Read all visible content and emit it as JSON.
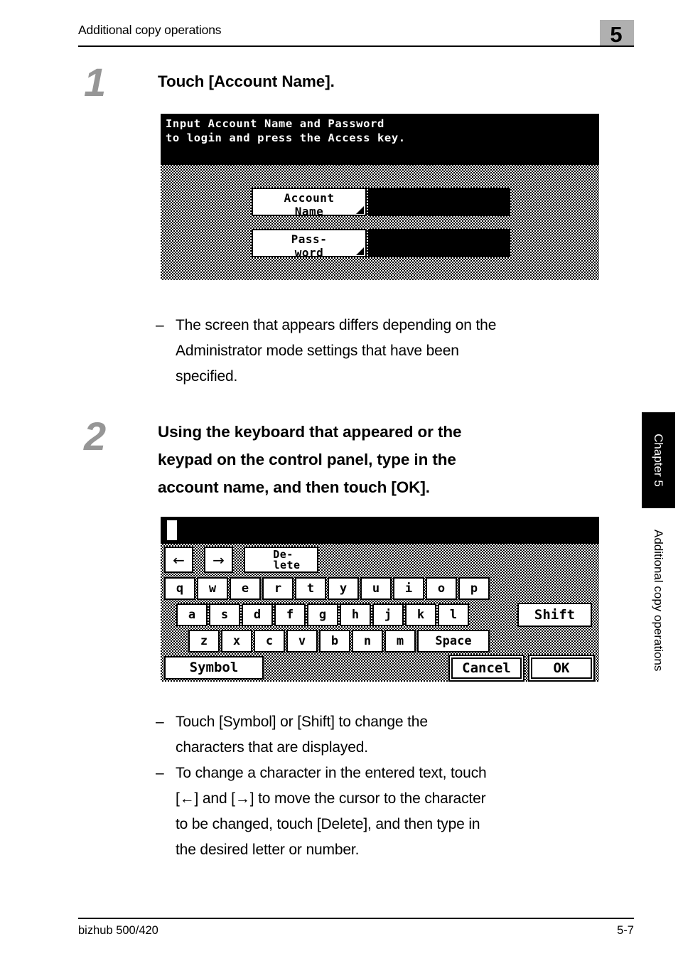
{
  "header": {
    "title": "Additional copy operations",
    "chapter_number": "5"
  },
  "footer": {
    "product": "bizhub 500/420",
    "page_number": "5-7"
  },
  "side_tab": {
    "chapter_label": "Chapter 5",
    "section_label": "Additional copy operations"
  },
  "steps": [
    {
      "number": "1",
      "heading": "Touch [Account Name].",
      "notes": [
        "The screen that appears differs depending on the Administrator mode settings that have been specified."
      ]
    },
    {
      "number": "2",
      "heading": "Using the keyboard that appeared or the keypad on the control panel, type in the account name, and then touch [OK].",
      "notes": [
        "Touch [Symbol] or [Shift] to change the characters that are displayed.",
        "To change a character in the entered text, touch [←] and [→] to move the cursor to the character to be changed, touch [Delete], and then type in the desired letter or number."
      ]
    }
  ],
  "step1_heading_lines": [
    "Touch [Account Name]."
  ],
  "step2_heading_lines": [
    "Using the keyboard that appeared or the",
    "keypad on the control panel, type in the",
    "account name, and then touch [OK]."
  ],
  "note1_lines": [
    "The screen that appears differs depending on the",
    "Administrator mode settings that have been",
    "specified."
  ],
  "note2_lines": [
    "Touch [Symbol] or [Shift] to change the",
    "characters that are displayed."
  ],
  "note3_lines": [
    "To change a character in the entered text, touch",
    "[←] and [→] to move the cursor to the character",
    "to be changed, touch [Delete], and then type in",
    "the desired letter or number."
  ],
  "bullet_dash": "–",
  "screen_login": {
    "title_line1": "Input Account Name and Password",
    "title_line2": "to login and press the Access key.",
    "account_name_button": {
      "line1": "Account",
      "line2": "Name"
    },
    "password_button": {
      "line1": "Pass-",
      "line2": "word"
    },
    "account_name_value": "",
    "password_value": ""
  },
  "screen_keyboard": {
    "input_value": "",
    "nav_keys": [
      {
        "name": "cursor-left",
        "label": "←"
      },
      {
        "name": "cursor-right",
        "label": "→"
      }
    ],
    "delete_key": {
      "line1": "De-",
      "line2": "lete"
    },
    "row1": [
      "q",
      "w",
      "e",
      "r",
      "t",
      "y",
      "u",
      "i",
      "o",
      "p"
    ],
    "row2": [
      "a",
      "s",
      "d",
      "f",
      "g",
      "h",
      "j",
      "k",
      "l"
    ],
    "row3": [
      "z",
      "x",
      "c",
      "v",
      "b",
      "n",
      "m"
    ],
    "space_key": "Space",
    "shift_key": "Shift",
    "symbol_key": "Symbol",
    "cancel_key": "Cancel",
    "ok_key": "OK"
  },
  "colors": {
    "chapter_box": "#b0b0b0",
    "step_number": "#969696",
    "lcd_black": "#000000",
    "page_background": "#ffffff"
  }
}
